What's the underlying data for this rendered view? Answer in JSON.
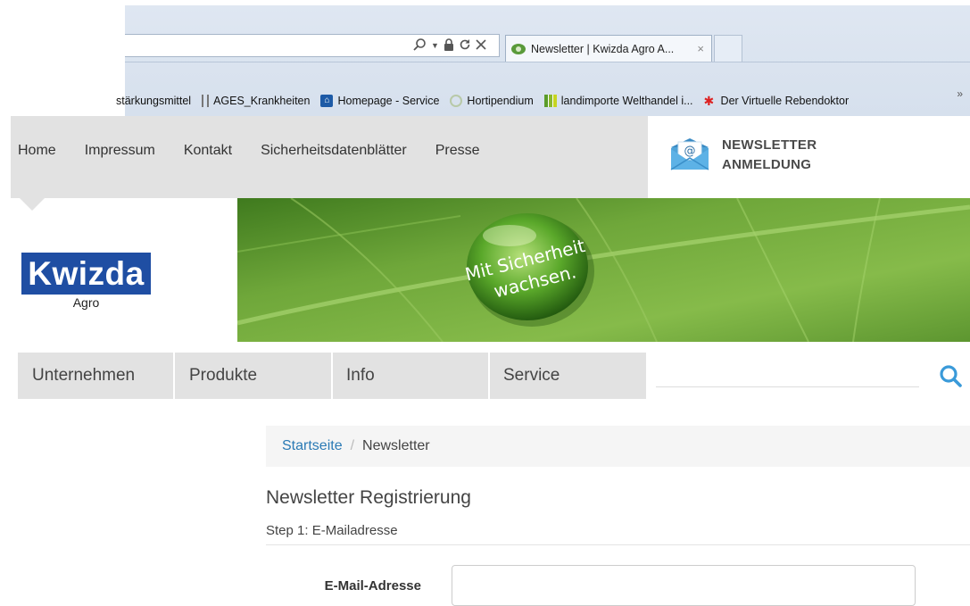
{
  "browser": {
    "tab_title": "Newsletter | Kwizda Agro A...",
    "tab_close": "×",
    "address_icons": [
      "search-icon",
      "dropdown-icon",
      "lock-icon",
      "refresh-icon",
      "stop-icon"
    ],
    "favorites": [
      {
        "label": "stärkungsmittel",
        "icon": "none"
      },
      {
        "label": "AGES_Krankheiten",
        "icon": "ages-icon"
      },
      {
        "label": "Homepage - Service",
        "icon": "homepage-icon"
      },
      {
        "label": "Hortipendium",
        "icon": "hortipendium-icon"
      },
      {
        "label": "landimporte Welthandel i...",
        "icon": "landimporte-icon"
      },
      {
        "label": "Der Virtuelle Rebendoktor",
        "icon": "rebendoktor-icon"
      }
    ],
    "favorites_more": "»"
  },
  "topnav": {
    "links": [
      "Home",
      "Impressum",
      "Kontakt",
      "Sicherheitsdatenblätter",
      "Presse"
    ]
  },
  "newsletter_signup": {
    "line1": "NEWSLETTER",
    "line2": "ANMELDUNG"
  },
  "logo": {
    "brand": "Kwizda",
    "sub": "Agro"
  },
  "banner": {
    "slogan_line1": "Mit Sicherheit",
    "slogan_line2": "wachsen."
  },
  "mainnav": {
    "items": [
      "Unternehmen",
      "Produkte",
      "Info",
      "Service"
    ],
    "search_placeholder": ""
  },
  "breadcrumb": {
    "home": "Startseite",
    "separator": "/",
    "current": "Newsletter"
  },
  "content": {
    "title": "Newsletter Registrierung",
    "step": "Step 1: E-Mailadresse",
    "email_label": "E-Mail-Adresse",
    "email_value": ""
  },
  "colors": {
    "brand_blue": "#1f4ea3",
    "nav_gray": "#e2e2e2",
    "link_blue": "#2a7ab5",
    "search_icon_blue": "#3a9ad9"
  }
}
